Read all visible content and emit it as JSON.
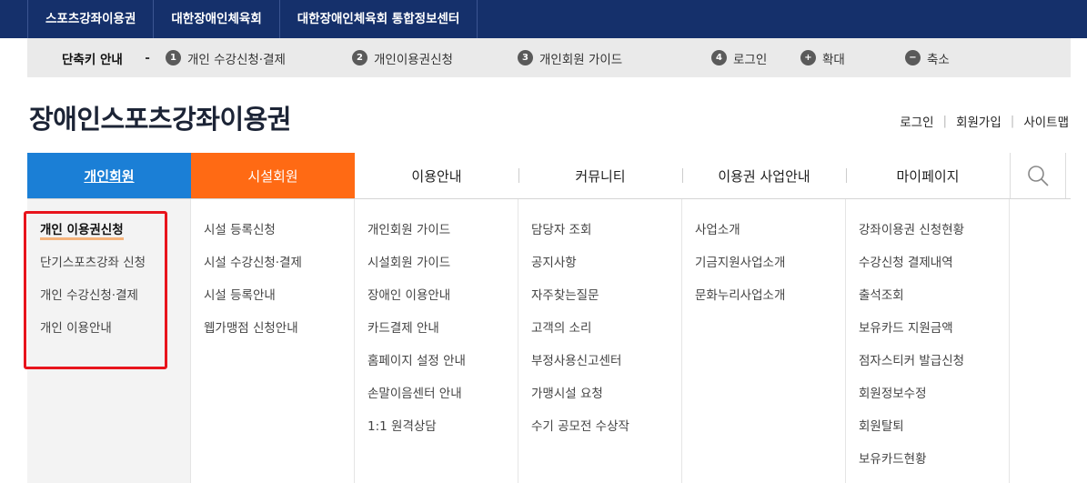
{
  "top_tabs": [
    "스포츠강좌이용권",
    "대한장애인체육회",
    "대한장애인체육회 통합정보센터"
  ],
  "shortcut": {
    "label": "단축키 안내",
    "dash": "-",
    "items": [
      {
        "key": "1",
        "text": "개인 수강신청·결제"
      },
      {
        "key": "2",
        "text": "개인이용권신청"
      },
      {
        "key": "3",
        "text": "개인회원 가이드"
      },
      {
        "key": "4",
        "text": "로그인"
      },
      {
        "key": "+",
        "text": "확대"
      },
      {
        "key": "−",
        "text": "축소"
      }
    ]
  },
  "logo": "장애인스포츠강좌이용권",
  "util_links": [
    "로그인",
    "회원가입",
    "사이트맵"
  ],
  "nav": [
    "개인회원",
    "시설회원",
    "이용안내",
    "커뮤니티",
    "이용권 사업안내",
    "마이페이지"
  ],
  "menus": [
    [
      "개인 이용권신청",
      "단기스포츠강좌 신청",
      "개인 수강신청·결제",
      "개인 이용안내"
    ],
    [
      "시설 등록신청",
      "시설 수강신청·결제",
      "시설 등록안내",
      "웹가맹점 신청안내"
    ],
    [
      "개인회원 가이드",
      "시설회원 가이드",
      "장애인 이용안내",
      "카드결제 안내",
      "홈페이지 설정 안내",
      "손말이음센터 안내",
      "1:1 원격상담"
    ],
    [
      "담당자 조회",
      "공지사항",
      "자주찾는질문",
      "고객의 소리",
      "부정사용신고센터",
      "가맹시설 요청",
      "수기 공모전 수상작"
    ],
    [
      "사업소개",
      "기금지원사업소개",
      "문화누리사업소개"
    ],
    [
      "강좌이용권 신청현황",
      "수강신청 결제내역",
      "출석조회",
      "보유카드 지원금액",
      "점자스티커 발급신청",
      "회원정보수정",
      "회원탈퇴",
      "보유카드현황"
    ]
  ],
  "colors": {
    "top_bar": "#15306b",
    "nav_active_blue": "#1b7fd6",
    "nav_orange": "#ff6a14",
    "highlight_box": "#e8141c"
  }
}
